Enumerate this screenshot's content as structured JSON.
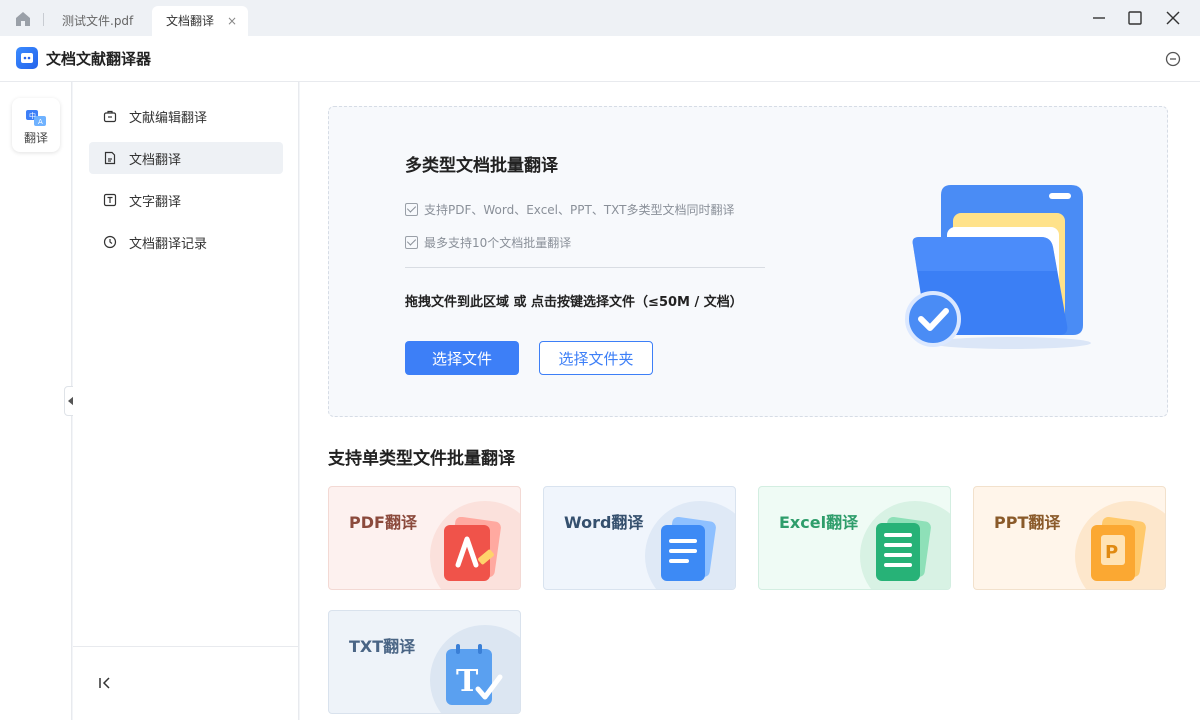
{
  "tabs": {
    "tab1_label": "测试文件.pdf",
    "tab2_label": "文档翻译",
    "close_glyph": "×"
  },
  "app": {
    "title": "文档文献翻译器"
  },
  "rail": {
    "item_label": "翻译"
  },
  "sidebar": {
    "items": [
      {
        "label": "文献编辑翻译",
        "icon": "briefcase-icon"
      },
      {
        "label": "文档翻译",
        "icon": "document-icon",
        "active": true
      },
      {
        "label": "文字翻译",
        "icon": "text-icon"
      },
      {
        "label": "文档翻译记录",
        "icon": "clock-icon"
      }
    ]
  },
  "dropzone": {
    "title": "多类型文档批量翻译",
    "features": [
      "支持PDF、Word、Excel、PPT、TXT多类型文档同时翻译",
      "最多支持10个文档批量翻译"
    ],
    "hint": "拖拽文件到此区域 或 点击按键选择文件（≤50M / 文档）",
    "select_file_label": "选择文件",
    "select_folder_label": "选择文件夹"
  },
  "section": {
    "title": "支持单类型文件批量翻译"
  },
  "cards": {
    "pdf": {
      "label": "PDF翻译",
      "color": "#8b4a3c"
    },
    "word": {
      "label": "Word翻译",
      "color": "#35506e"
    },
    "excel": {
      "label": "Excel翻译",
      "color": "#2e9d6b"
    },
    "ppt": {
      "label": "PPT翻译",
      "color": "#8a5a2a"
    },
    "txt": {
      "label": "TXT翻译",
      "color": "#4a6585"
    }
  },
  "colors": {
    "accent": "#3d7ff7"
  }
}
